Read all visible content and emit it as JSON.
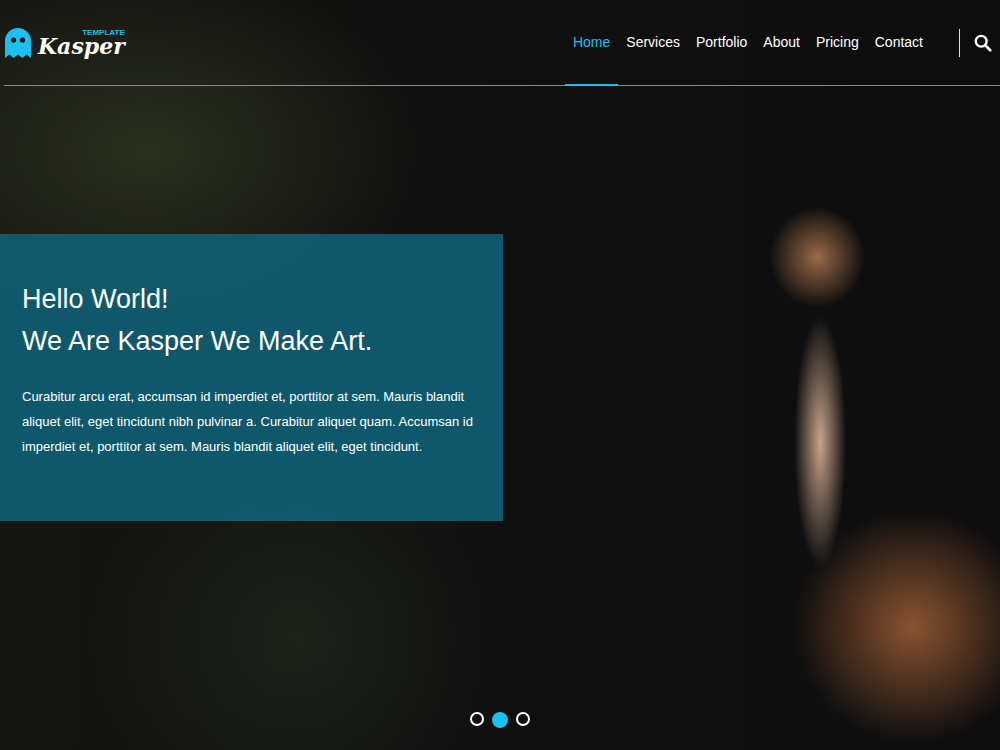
{
  "logo": {
    "name": "Kasper",
    "tag": "TEMPLATE"
  },
  "nav": [
    {
      "label": "Home",
      "selected": true
    },
    {
      "label": "Services",
      "selected": false
    },
    {
      "label": "Portfolio",
      "selected": false
    },
    {
      "label": "About",
      "selected": false
    },
    {
      "label": "Pricing",
      "selected": false
    },
    {
      "label": "Contact",
      "selected": false
    }
  ],
  "hero": {
    "title": [
      "Hello World!",
      "We Are Kasper We Make Art."
    ],
    "text": "Curabitur arcu erat, accumsan id imperdiet et, porttitor at sem. Mauris blandit aliquet elit, eget tincidunt nibh pulvinar a. Curabitur aliquet quam. Accumsan id imperdiet et, porttitor at sem. Mauris blandit aliquet elit, eget tincidunt."
  },
  "slider": {
    "dots": [
      {
        "selected": false
      },
      {
        "selected": true
      },
      {
        "selected": false
      }
    ]
  }
}
